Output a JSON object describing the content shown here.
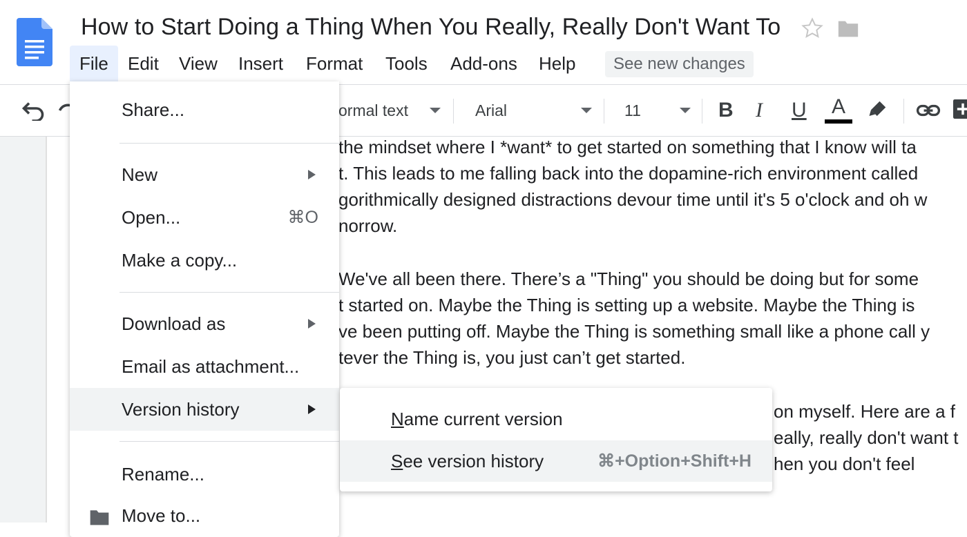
{
  "app": {
    "title": "How to Start Doing a Thing When You Really, Really Don't Want To",
    "colors": {
      "docs_blue": "#4285f4",
      "menu_active_bg": "#e8f0fe",
      "hover_bg": "#f1f3f4"
    }
  },
  "menubar": {
    "items": [
      "File",
      "Edit",
      "View",
      "Insert",
      "Format",
      "Tools",
      "Add-ons",
      "Help"
    ],
    "active": "File",
    "see_new_changes": "See new changes"
  },
  "toolbar": {
    "style": "ormal text",
    "font": "Arial",
    "size": "11",
    "bold": "B",
    "italic": "I",
    "underline": "U",
    "text_color": "A"
  },
  "file_menu": {
    "share": "Share...",
    "new": "New",
    "open": "Open...",
    "open_shortcut": "⌘O",
    "make_copy": "Make a copy...",
    "download_as": "Download as",
    "email_attachment": "Email as attachment...",
    "version_history": "Version history",
    "rename": "Rename...",
    "move_to": "Move to..."
  },
  "version_submenu": {
    "name_current": "Name current version",
    "see_history": "See version history",
    "see_history_shortcut": "⌘+Option+Shift+H"
  },
  "document": {
    "lines": [
      " the mindset where I *want* to get started on something that I know will ta",
      "t. This leads to me falling back into the dopamine-rich environment called",
      "gorithmically designed distractions devour time until it's 5 o'clock and oh w",
      "norrow.",
      "We've all been there. There’s a \"Thing\" you should be doing but for some",
      "t started on. Maybe the Thing is setting up a website. Maybe the Thing is",
      "ve been putting off. Maybe the Thing is something small like a phone call y",
      "tever the Thing is, you just can’t get started.",
      "on myself. Here are a f",
      "eally, really don't want t",
      "hen you don't feel"
    ]
  }
}
